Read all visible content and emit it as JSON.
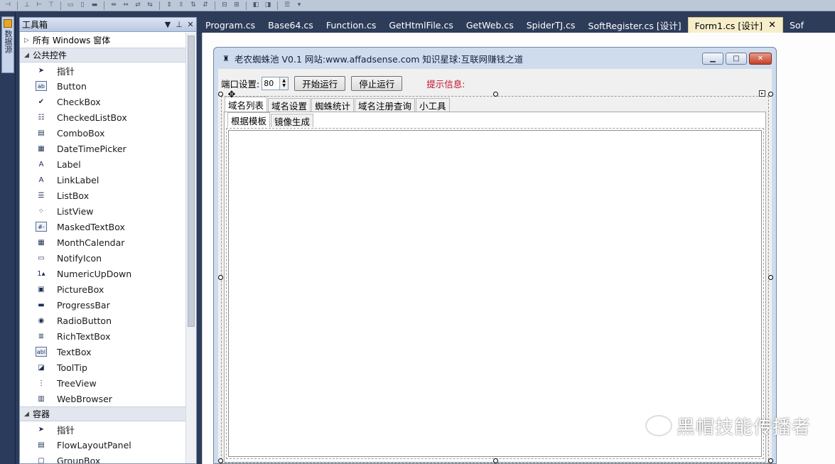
{
  "toolbox": {
    "title": "工具箱",
    "pin_label": "▼ 4",
    "close_label": "✕",
    "groups": [
      {
        "label": "所有 Windows 窗体",
        "expanded": false
      },
      {
        "label": "公共控件",
        "expanded": true
      },
      {
        "label": "容器",
        "expanded": true
      }
    ],
    "common_items": [
      {
        "label": "指针",
        "icon": "pointer-icon",
        "glyph": "➤"
      },
      {
        "label": "Button",
        "icon": "button-icon",
        "glyph": "ab"
      },
      {
        "label": "CheckBox",
        "icon": "checkbox-icon",
        "glyph": "✔"
      },
      {
        "label": "CheckedListBox",
        "icon": "checkedlistbox-icon",
        "glyph": "☷"
      },
      {
        "label": "ComboBox",
        "icon": "combobox-icon",
        "glyph": "▤"
      },
      {
        "label": "DateTimePicker",
        "icon": "datetimepicker-icon",
        "glyph": "▦"
      },
      {
        "label": "Label",
        "icon": "label-icon",
        "glyph": "A"
      },
      {
        "label": "LinkLabel",
        "icon": "linklabel-icon",
        "glyph": "A"
      },
      {
        "label": "ListBox",
        "icon": "listbox-icon",
        "glyph": "☰"
      },
      {
        "label": "ListView",
        "icon": "listview-icon",
        "glyph": "⁘"
      },
      {
        "label": "MaskedTextBox",
        "icon": "maskedtextbox-icon",
        "glyph": "#-"
      },
      {
        "label": "MonthCalendar",
        "icon": "monthcalendar-icon",
        "glyph": "▦"
      },
      {
        "label": "NotifyIcon",
        "icon": "notifyicon-icon",
        "glyph": "▭"
      },
      {
        "label": "NumericUpDown",
        "icon": "numericupdown-icon",
        "glyph": "1▴"
      },
      {
        "label": "PictureBox",
        "icon": "picturebox-icon",
        "glyph": "▣"
      },
      {
        "label": "ProgressBar",
        "icon": "progressbar-icon",
        "glyph": "▬"
      },
      {
        "label": "RadioButton",
        "icon": "radiobutton-icon",
        "glyph": "◉"
      },
      {
        "label": "RichTextBox",
        "icon": "richtextbox-icon",
        "glyph": "≣"
      },
      {
        "label": "TextBox",
        "icon": "textbox-icon",
        "glyph": "abl"
      },
      {
        "label": "ToolTip",
        "icon": "tooltip-icon",
        "glyph": "◪"
      },
      {
        "label": "TreeView",
        "icon": "treeview-icon",
        "glyph": "⋮"
      },
      {
        "label": "WebBrowser",
        "icon": "webbrowser-icon",
        "glyph": "▥"
      }
    ],
    "container_items": [
      {
        "label": "指针",
        "icon": "pointer-icon",
        "glyph": "➤"
      },
      {
        "label": "FlowLayoutPanel",
        "icon": "flowlayoutpanel-icon",
        "glyph": "▤"
      },
      {
        "label": "GroupBox",
        "icon": "groupbox-icon",
        "glyph": "▢"
      }
    ]
  },
  "side_strip": {
    "label": "数据源"
  },
  "doc_tabs": [
    {
      "label": "Program.cs",
      "active": false
    },
    {
      "label": "Base64.cs",
      "active": false
    },
    {
      "label": "Function.cs",
      "active": false
    },
    {
      "label": "GetHtmlFile.cs",
      "active": false
    },
    {
      "label": "GetWeb.cs",
      "active": false
    },
    {
      "label": "SpiderTJ.cs",
      "active": false
    },
    {
      "label": "SoftRegister.cs [设计]",
      "active": false
    },
    {
      "label": "Form1.cs [设计]",
      "active": true
    },
    {
      "label": "Sof",
      "active": false
    }
  ],
  "form": {
    "title": "老农蜘蛛池 V0.1  网站:www.affadsense.com 知识星球:互联网赚钱之道",
    "port_label": "端口设置:",
    "port_value": "80",
    "start_button": "开始运行",
    "stop_button": "停止运行",
    "hint_label": "提示信息:",
    "tabs": [
      "域名列表",
      "域名设置",
      "蜘蛛统计",
      "域名注册查询",
      "小工具"
    ],
    "inner_tabs": [
      "根据模板",
      "镜像生成"
    ]
  },
  "watermark": {
    "text": "黑帽技能传播者"
  }
}
